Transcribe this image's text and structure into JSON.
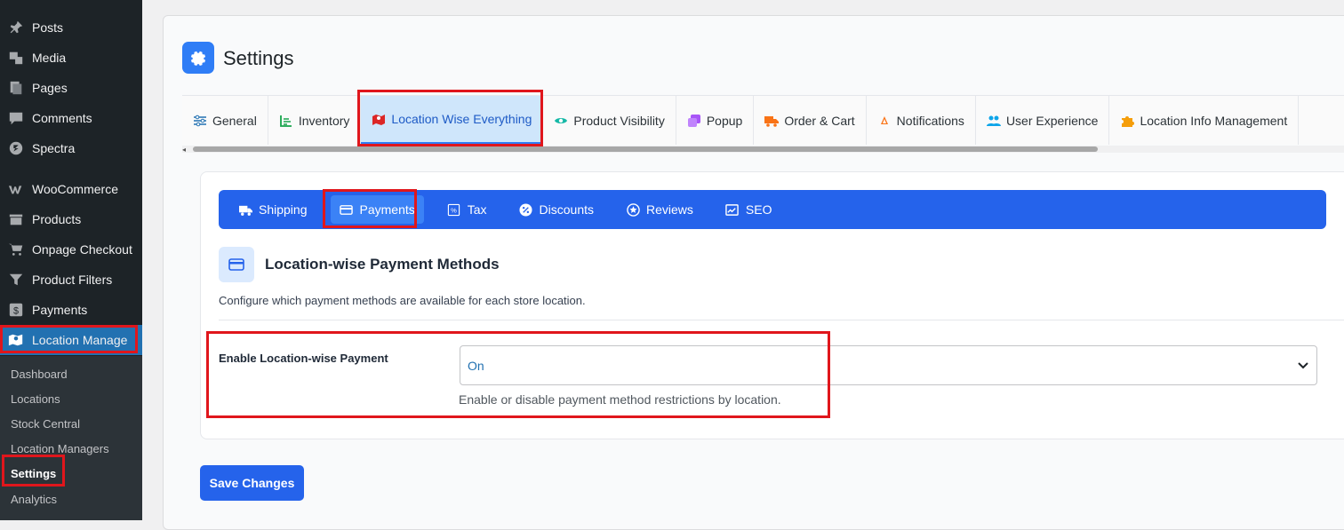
{
  "sidebar": {
    "items": [
      {
        "label": "Posts",
        "icon": "pin-icon"
      },
      {
        "label": "Media",
        "icon": "media-icon"
      },
      {
        "label": "Pages",
        "icon": "pages-icon"
      },
      {
        "label": "Comments",
        "icon": "comment-icon"
      },
      {
        "label": "Spectra",
        "icon": "spectra-icon"
      },
      {
        "label": "WooCommerce",
        "icon": "woocommerce-icon"
      },
      {
        "label": "Products",
        "icon": "products-icon"
      },
      {
        "label": "Onpage Checkout",
        "icon": "cart-icon"
      },
      {
        "label": "Product Filters",
        "icon": "filter-icon"
      },
      {
        "label": "Payments",
        "icon": "dollar-icon"
      },
      {
        "label": "Location Manage",
        "icon": "map-icon",
        "active": true
      }
    ],
    "submenu": [
      "Dashboard",
      "Locations",
      "Stock Central",
      "Location Managers",
      "Settings",
      "Analytics"
    ],
    "current_submenu": "Settings"
  },
  "header": {
    "title": "Settings"
  },
  "tabs": [
    {
      "label": "General",
      "icon": "sliders-icon",
      "color": "#2271b1"
    },
    {
      "label": "Inventory",
      "icon": "chart-icon",
      "color": "#16a34a"
    },
    {
      "label": "Location Wise Everything",
      "icon": "map-icon",
      "color": "#dc2626",
      "active": true
    },
    {
      "label": "Product Visibility",
      "icon": "eye-icon",
      "color": "#14b8a6"
    },
    {
      "label": "Popup",
      "icon": "popup-icon",
      "color": "#a855f7"
    },
    {
      "label": "Order & Cart",
      "icon": "truck-icon",
      "color": "#f97316"
    },
    {
      "label": "Notifications",
      "icon": "bell-icon",
      "color": "#f97316"
    },
    {
      "label": "User Experience",
      "icon": "users-icon",
      "color": "#0ea5e9"
    },
    {
      "label": "Location Info Management",
      "icon": "puzzle-icon",
      "color": "#f59e0b"
    }
  ],
  "subtabs": [
    {
      "label": "Shipping",
      "icon": "truck-icon"
    },
    {
      "label": "Payments",
      "icon": "card-icon",
      "active": true
    },
    {
      "label": "Tax",
      "icon": "percent-icon"
    },
    {
      "label": "Discounts",
      "icon": "discount-icon"
    },
    {
      "label": "Reviews",
      "icon": "star-icon"
    },
    {
      "label": "SEO",
      "icon": "seo-icon"
    }
  ],
  "section": {
    "title": "Location-wise Payment Methods",
    "description": "Configure which payment methods are available for each store location."
  },
  "field": {
    "label": "Enable Location-wise Payment",
    "value": "On",
    "help": "Enable or disable payment method restrictions by location."
  },
  "save_button": "Save Changes",
  "colors": {
    "accent": "#2563eb",
    "highlight": "#e0161c",
    "sidebar": "#1d2327"
  }
}
